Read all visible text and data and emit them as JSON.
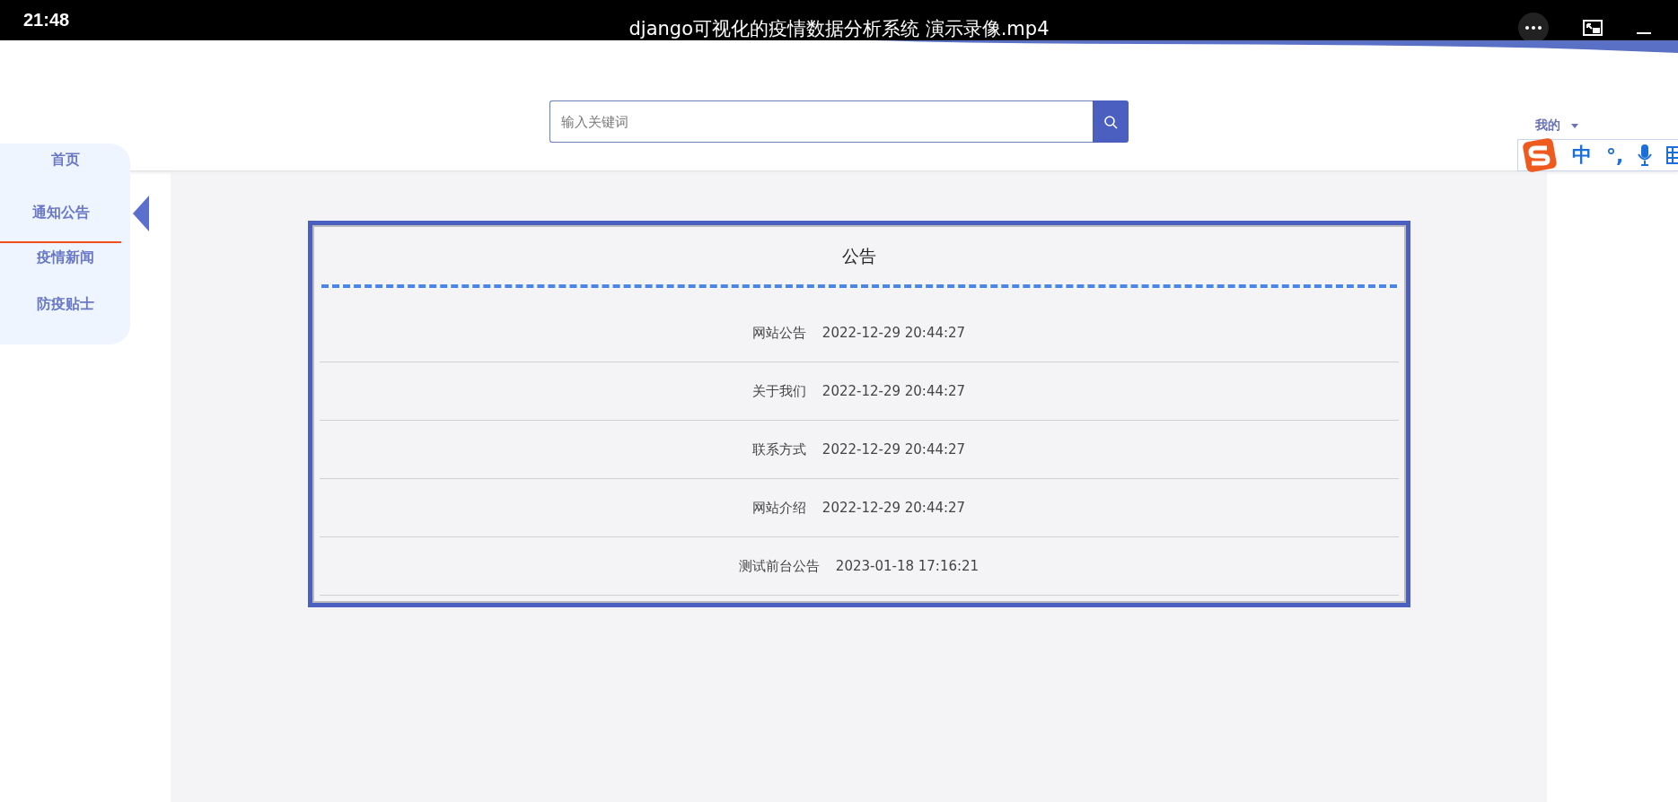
{
  "player_bar": {
    "time": "21:48",
    "title": "django可视化的疫情数据分析系统 演示录像.mp4"
  },
  "search": {
    "placeholder": "输入关键词"
  },
  "user_menu": {
    "label": "我的"
  },
  "ime_toolbar": {
    "mode": "中",
    "punctuation": "°,"
  },
  "sidebar": {
    "items": [
      {
        "label": "首页",
        "selected": false
      },
      {
        "label": "通知公告",
        "selected": true
      },
      {
        "label": "疫情新闻",
        "selected": false
      },
      {
        "label": "防疫贴士",
        "selected": false
      }
    ]
  },
  "notice_panel": {
    "title": "公告",
    "rows": [
      {
        "title": "网站公告",
        "time": "2022-12-29 20:44:27"
      },
      {
        "title": "关于我们",
        "time": "2022-12-29 20:44:27"
      },
      {
        "title": "联系方式",
        "time": "2022-12-29 20:44:27"
      },
      {
        "title": "网站介绍",
        "time": "2022-12-29 20:44:27"
      },
      {
        "title": "测试前台公告",
        "time": "2023-01-18 17:16:21"
      }
    ]
  }
}
